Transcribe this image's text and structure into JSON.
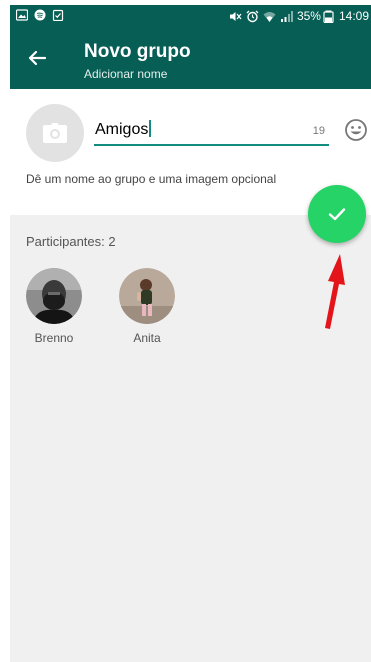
{
  "status_bar": {
    "left_icons": [
      "image-icon",
      "spotify-icon",
      "clipboard-icon"
    ],
    "right_icons": [
      "mute-icon",
      "alarm-icon",
      "wifi-icon",
      "signal-icon",
      "battery-icon"
    ],
    "battery": "35%",
    "time": "14:09"
  },
  "header": {
    "title": "Novo grupo",
    "subtitle": "Adicionar nome",
    "back_icon": "arrow-left-icon"
  },
  "group": {
    "name": "Amigos",
    "remaining_chars": "19",
    "hint": "Dê um nome ao grupo e uma imagem opcional",
    "photo_icon": "camera-icon",
    "emoji_icon": "smiley-icon"
  },
  "participants": {
    "label": "Participantes: 2",
    "items": [
      {
        "name": "Brenno"
      },
      {
        "name": "Anita"
      }
    ]
  },
  "fab": {
    "icon": "check-icon"
  },
  "colors": {
    "primary": "#075e54",
    "accent": "#128c7e",
    "fab": "#25d366",
    "annotation": "#e3151a"
  }
}
